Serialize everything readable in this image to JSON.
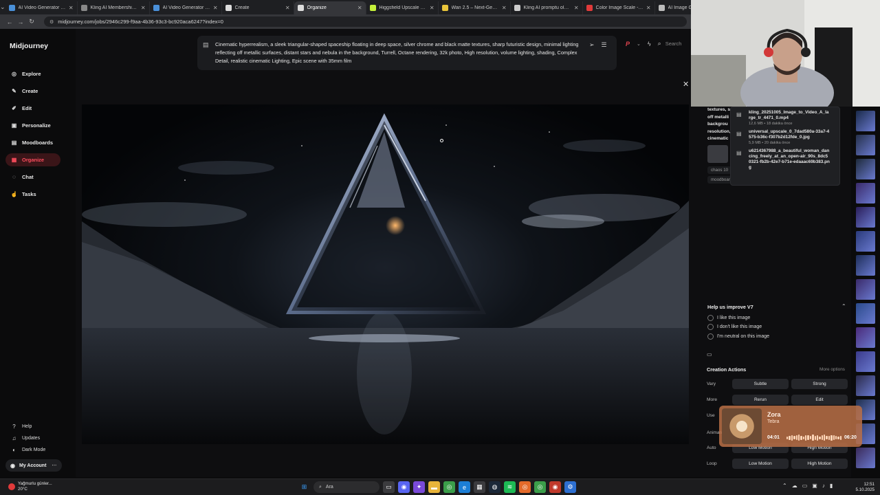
{
  "browser": {
    "tabs": [
      {
        "label": "AI Video Generator | Anim",
        "color": "#4a90d9"
      },
      {
        "label": "Kling AI Membership Plan",
        "color": "#888888"
      },
      {
        "label": "AI Video Generator | Anim",
        "color": "#4a90d9"
      },
      {
        "label": "Create",
        "color": "#dddddd"
      },
      {
        "label": "Organize",
        "color": "#dddddd",
        "active": true
      },
      {
        "label": "Higgsfield Upscale – AI Im",
        "color": "#c4f03a"
      },
      {
        "label": "Wan 2.5 – Next-Gen Video",
        "color": "#e8c43a"
      },
      {
        "label": "Kling AI promptu oluştur",
        "color": "#cccccc"
      },
      {
        "label": "Color Image Scale - Kobe",
        "color": "#e03a3a"
      },
      {
        "label": "AI Image G",
        "color": "#bbbbbb"
      }
    ],
    "url": "midjourney.com/jobs/2946c299-f9aa-4b36-93c3-bc920aca6247?index=0"
  },
  "sidebar": {
    "brand": "Midjourney",
    "items": [
      {
        "label": "Explore",
        "icon": "compass-icon",
        "glyph": "◎"
      },
      {
        "label": "Create",
        "icon": "pencil-icon",
        "glyph": "✎"
      },
      {
        "label": "Edit",
        "icon": "edit-icon",
        "glyph": "✐"
      },
      {
        "label": "Personalize",
        "icon": "personalize-icon",
        "glyph": "▣"
      },
      {
        "label": "Moodboards",
        "icon": "moodboard-icon",
        "glyph": "▤"
      },
      {
        "label": "Organize",
        "icon": "folder-icon",
        "glyph": "▦",
        "active": true
      },
      {
        "label": "Chat",
        "icon": "chat-icon",
        "glyph": "◌"
      },
      {
        "label": "Tasks",
        "icon": "thumbs-up-icon",
        "glyph": "☝"
      }
    ],
    "bottom": [
      {
        "label": "Help",
        "icon": "help-icon",
        "glyph": "?"
      },
      {
        "label": "Updates",
        "icon": "bell-icon",
        "glyph": "♫"
      },
      {
        "label": "Dark Mode",
        "icon": "moon-icon",
        "glyph": "◐"
      }
    ],
    "account": "My Account"
  },
  "main": {
    "prompt": "Cinematic hyperrealism, a sleek triangular-shaped spaceship floating in deep space, silver chrome and black matte textures, sharp futuristic design, minimal lighting reflecting off metallic surfaces, distant stars and nebula in the background, Turrell, Octane rendering, 32k photo, High resolution, volume lighting, shading, Complex Detail, realistic cinematic Lighting, Epic scene with 35mm film",
    "search_placeholder": "Search"
  },
  "right_panel": {
    "prompt_fragment": "textures, s off metalli backgrou resolution, cinematic",
    "chips": [
      "chaos 10",
      "moodboar"
    ],
    "downloads": [
      {
        "name": "kling_20251005_Image_to_Video_A_large_tr_4471_0.mp4",
        "meta": "12,6 MB • 18 dakika önce"
      },
      {
        "name": "universal_upscale_0_7dad580a-33a7-4575-b36c-f307b2d12fde_0.jpg",
        "meta": "5,9 MB • 20 dakika önce"
      },
      {
        "name": "u6214367988_a_beautiful_woman_dancing_freely_at_an_open-air_90s_8dc50321-fb2b-42e7-b71e-edaaac69b383.png",
        "meta": ""
      }
    ],
    "help_title": "Help us improve V7",
    "feedback": [
      "I like this image",
      "I don't like this image",
      "I'm neutral on this image"
    ],
    "creation_actions": {
      "title": "Creation Actions",
      "more_options": "More options",
      "rows": [
        {
          "label": "Vary",
          "buttons": [
            "Subtle",
            "Strong"
          ]
        },
        {
          "label": "More",
          "buttons": [
            "Rerun",
            "Edit"
          ]
        },
        {
          "label": "Use",
          "buttons": []
        },
        {
          "label": "Animate",
          "buttons": []
        },
        {
          "label": "Auto",
          "buttons": [
            "Low Motion",
            "High Motion"
          ]
        },
        {
          "label": "Loop",
          "buttons": [
            "Low Motion",
            "High Motion"
          ]
        }
      ]
    }
  },
  "music": {
    "title": "Zora",
    "artist": "Tebra",
    "elapsed": "04:01",
    "total": "06:20"
  },
  "taskbar": {
    "weather_line1": "Yağmurlu günler...",
    "weather_line2": "20°C",
    "search": "Ara",
    "time": "12:51",
    "date": "5.10.2025"
  },
  "colors": {
    "accent": "#ff4d5e",
    "active_bg": "#3a1518",
    "music_bg": "#ba7046"
  }
}
